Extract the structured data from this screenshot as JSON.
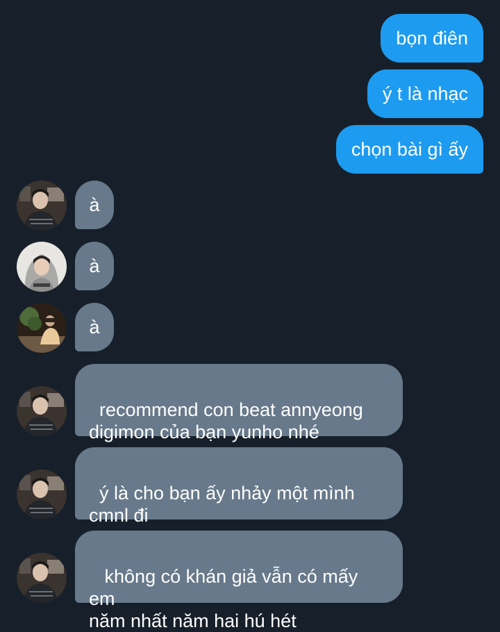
{
  "conversation": {
    "sent": [
      {
        "text": "bọn điên"
      },
      {
        "text": "ý t là nhạc"
      },
      {
        "text": "chọn bài gì ấy"
      }
    ],
    "received": [
      {
        "text": "à",
        "avatar": "avatar-boy-sweater"
      },
      {
        "text": "à",
        "avatar": "avatar-boy-hoodie"
      },
      {
        "text": "à",
        "avatar": "avatar-person-room"
      },
      {
        "text": "recommend con beat annyeong\ndigimon của bạn yunho nhé",
        "avatar": "avatar-boy-sweater"
      },
      {
        "text": "ý là cho bạn ấy nhảy một mình\ncmnl đi",
        "avatar": "avatar-boy-sweater"
      },
      {
        "text": " không có khán giả vẫn có mấy em\nnăm nhất năm hai hú hét",
        "avatar": "avatar-boy-sweater"
      }
    ]
  },
  "colors": {
    "background": "#17202a",
    "sent_bubble": "#1d9bf0",
    "received_bubble": "#67798a",
    "text": "#ffffff"
  }
}
